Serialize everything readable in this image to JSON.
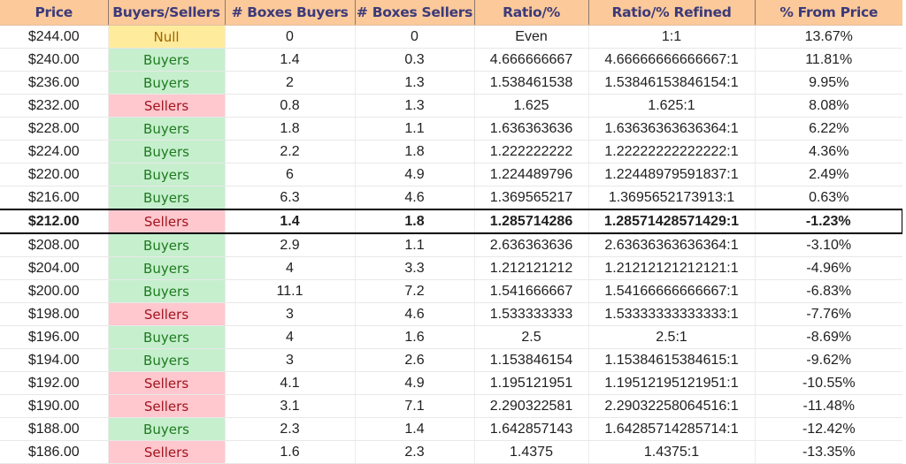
{
  "colors": {
    "header_bg": "#fcc99a",
    "header_text": "#3b3a7a",
    "buyers_bg": "#c6efce",
    "buyers_text": "#1e7a1e",
    "sellers_bg": "#ffc7ce",
    "sellers_text": "#a0141e",
    "null_bg": "#ffeb9c",
    "null_text": "#9c6500"
  },
  "table": {
    "headers": [
      "Price",
      "Buyers/Sellers",
      "# Boxes Buyers",
      "# Boxes Sellers",
      "Ratio/%",
      "Ratio/% Refined",
      "% From Price"
    ],
    "highlighted_row_index": 8,
    "rows": [
      {
        "price": "$244.00",
        "side": "Null",
        "boxes_buyers": "0",
        "boxes_sellers": "0",
        "ratio": "Even",
        "ratio_refined": "1:1",
        "pct_from_price": "13.67%"
      },
      {
        "price": "$240.00",
        "side": "Buyers",
        "boxes_buyers": "1.4",
        "boxes_sellers": "0.3",
        "ratio": "4.666666667",
        "ratio_refined": "4.66666666666667:1",
        "pct_from_price": "11.81%"
      },
      {
        "price": "$236.00",
        "side": "Buyers",
        "boxes_buyers": "2",
        "boxes_sellers": "1.3",
        "ratio": "1.538461538",
        "ratio_refined": "1.53846153846154:1",
        "pct_from_price": "9.95%"
      },
      {
        "price": "$232.00",
        "side": "Sellers",
        "boxes_buyers": "0.8",
        "boxes_sellers": "1.3",
        "ratio": "1.625",
        "ratio_refined": "1.625:1",
        "pct_from_price": "8.08%"
      },
      {
        "price": "$228.00",
        "side": "Buyers",
        "boxes_buyers": "1.8",
        "boxes_sellers": "1.1",
        "ratio": "1.636363636",
        "ratio_refined": "1.63636363636364:1",
        "pct_from_price": "6.22%"
      },
      {
        "price": "$224.00",
        "side": "Buyers",
        "boxes_buyers": "2.2",
        "boxes_sellers": "1.8",
        "ratio": "1.222222222",
        "ratio_refined": "1.22222222222222:1",
        "pct_from_price": "4.36%"
      },
      {
        "price": "$220.00",
        "side": "Buyers",
        "boxes_buyers": "6",
        "boxes_sellers": "4.9",
        "ratio": "1.224489796",
        "ratio_refined": "1.22448979591837:1",
        "pct_from_price": "2.49%"
      },
      {
        "price": "$216.00",
        "side": "Buyers",
        "boxes_buyers": "6.3",
        "boxes_sellers": "4.6",
        "ratio": "1.369565217",
        "ratio_refined": "1.3695652173913:1",
        "pct_from_price": "0.63%"
      },
      {
        "price": "$212.00",
        "side": "Sellers",
        "boxes_buyers": "1.4",
        "boxes_sellers": "1.8",
        "ratio": "1.285714286",
        "ratio_refined": "1.28571428571429:1",
        "pct_from_price": "-1.23%"
      },
      {
        "price": "$208.00",
        "side": "Buyers",
        "boxes_buyers": "2.9",
        "boxes_sellers": "1.1",
        "ratio": "2.636363636",
        "ratio_refined": "2.63636363636364:1",
        "pct_from_price": "-3.10%"
      },
      {
        "price": "$204.00",
        "side": "Buyers",
        "boxes_buyers": "4",
        "boxes_sellers": "3.3",
        "ratio": "1.212121212",
        "ratio_refined": "1.21212121212121:1",
        "pct_from_price": "-4.96%"
      },
      {
        "price": "$200.00",
        "side": "Buyers",
        "boxes_buyers": "11.1",
        "boxes_sellers": "7.2",
        "ratio": "1.541666667",
        "ratio_refined": "1.54166666666667:1",
        "pct_from_price": "-6.83%"
      },
      {
        "price": "$198.00",
        "side": "Sellers",
        "boxes_buyers": "3",
        "boxes_sellers": "4.6",
        "ratio": "1.533333333",
        "ratio_refined": "1.53333333333333:1",
        "pct_from_price": "-7.76%"
      },
      {
        "price": "$196.00",
        "side": "Buyers",
        "boxes_buyers": "4",
        "boxes_sellers": "1.6",
        "ratio": "2.5",
        "ratio_refined": "2.5:1",
        "pct_from_price": "-8.69%"
      },
      {
        "price": "$194.00",
        "side": "Buyers",
        "boxes_buyers": "3",
        "boxes_sellers": "2.6",
        "ratio": "1.153846154",
        "ratio_refined": "1.15384615384615:1",
        "pct_from_price": "-9.62%"
      },
      {
        "price": "$192.00",
        "side": "Sellers",
        "boxes_buyers": "4.1",
        "boxes_sellers": "4.9",
        "ratio": "1.195121951",
        "ratio_refined": "1.19512195121951:1",
        "pct_from_price": "-10.55%"
      },
      {
        "price": "$190.00",
        "side": "Sellers",
        "boxes_buyers": "3.1",
        "boxes_sellers": "7.1",
        "ratio": "2.290322581",
        "ratio_refined": "2.29032258064516:1",
        "pct_from_price": "-11.48%"
      },
      {
        "price": "$188.00",
        "side": "Buyers",
        "boxes_buyers": "2.3",
        "boxes_sellers": "1.4",
        "ratio": "1.642857143",
        "ratio_refined": "1.64285714285714:1",
        "pct_from_price": "-12.42%"
      },
      {
        "price": "$186.00",
        "side": "Sellers",
        "boxes_buyers": "1.6",
        "boxes_sellers": "2.3",
        "ratio": "1.4375",
        "ratio_refined": "1.4375:1",
        "pct_from_price": "-13.35%"
      }
    ]
  }
}
